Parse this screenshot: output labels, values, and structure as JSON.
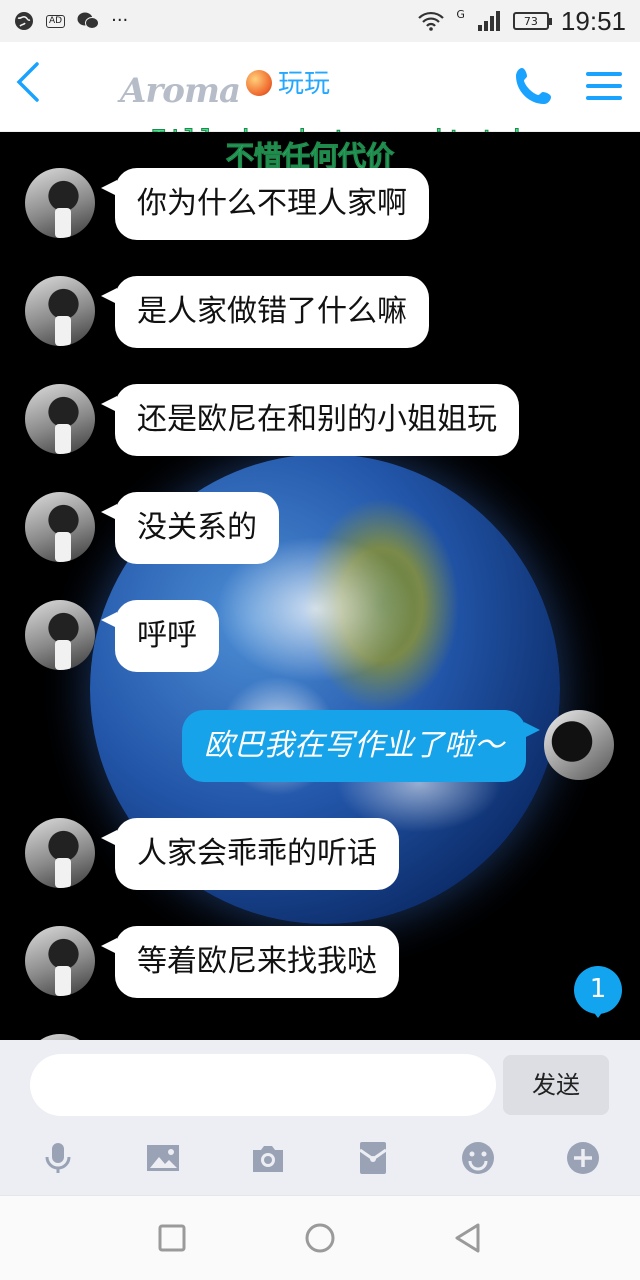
{
  "status_bar": {
    "left_icons": [
      "globe-icon",
      "ad-icon",
      "wechat-icon",
      "more-icon"
    ],
    "ad_label": "AD",
    "more_label": "···",
    "network": "G",
    "battery": "73",
    "time": "19:51"
  },
  "header": {
    "logo_text": "Aroma",
    "contact_name": "玩玩",
    "lyric_en": "I'll do whatever it takes",
    "lyric_cn": "不惜任何代价"
  },
  "messages": [
    {
      "from": "them",
      "text": "你为什么不理人家啊"
    },
    {
      "from": "them",
      "text": "是人家做错了什么嘛"
    },
    {
      "from": "them",
      "text": "还是欧尼在和别的小姐姐玩"
    },
    {
      "from": "them",
      "text": "没关系的"
    },
    {
      "from": "them",
      "text": "呼呼"
    },
    {
      "from": "me",
      "text": "欧巴我在写作业了啦～"
    },
    {
      "from": "them",
      "text": "人家会乖乖的听话"
    },
    {
      "from": "them",
      "text": "等着欧尼来找我哒"
    }
  ],
  "unread_count": "1",
  "input": {
    "placeholder": "",
    "send_label": "发送"
  },
  "toolbar_icons": [
    "microphone-icon",
    "image-icon",
    "camera-icon",
    "red-packet-icon",
    "emoji-icon",
    "plus-icon"
  ],
  "colors": {
    "accent": "#1aa2ff",
    "bubble_me": "#17a3ea",
    "lyric_green": "#47e08a"
  }
}
